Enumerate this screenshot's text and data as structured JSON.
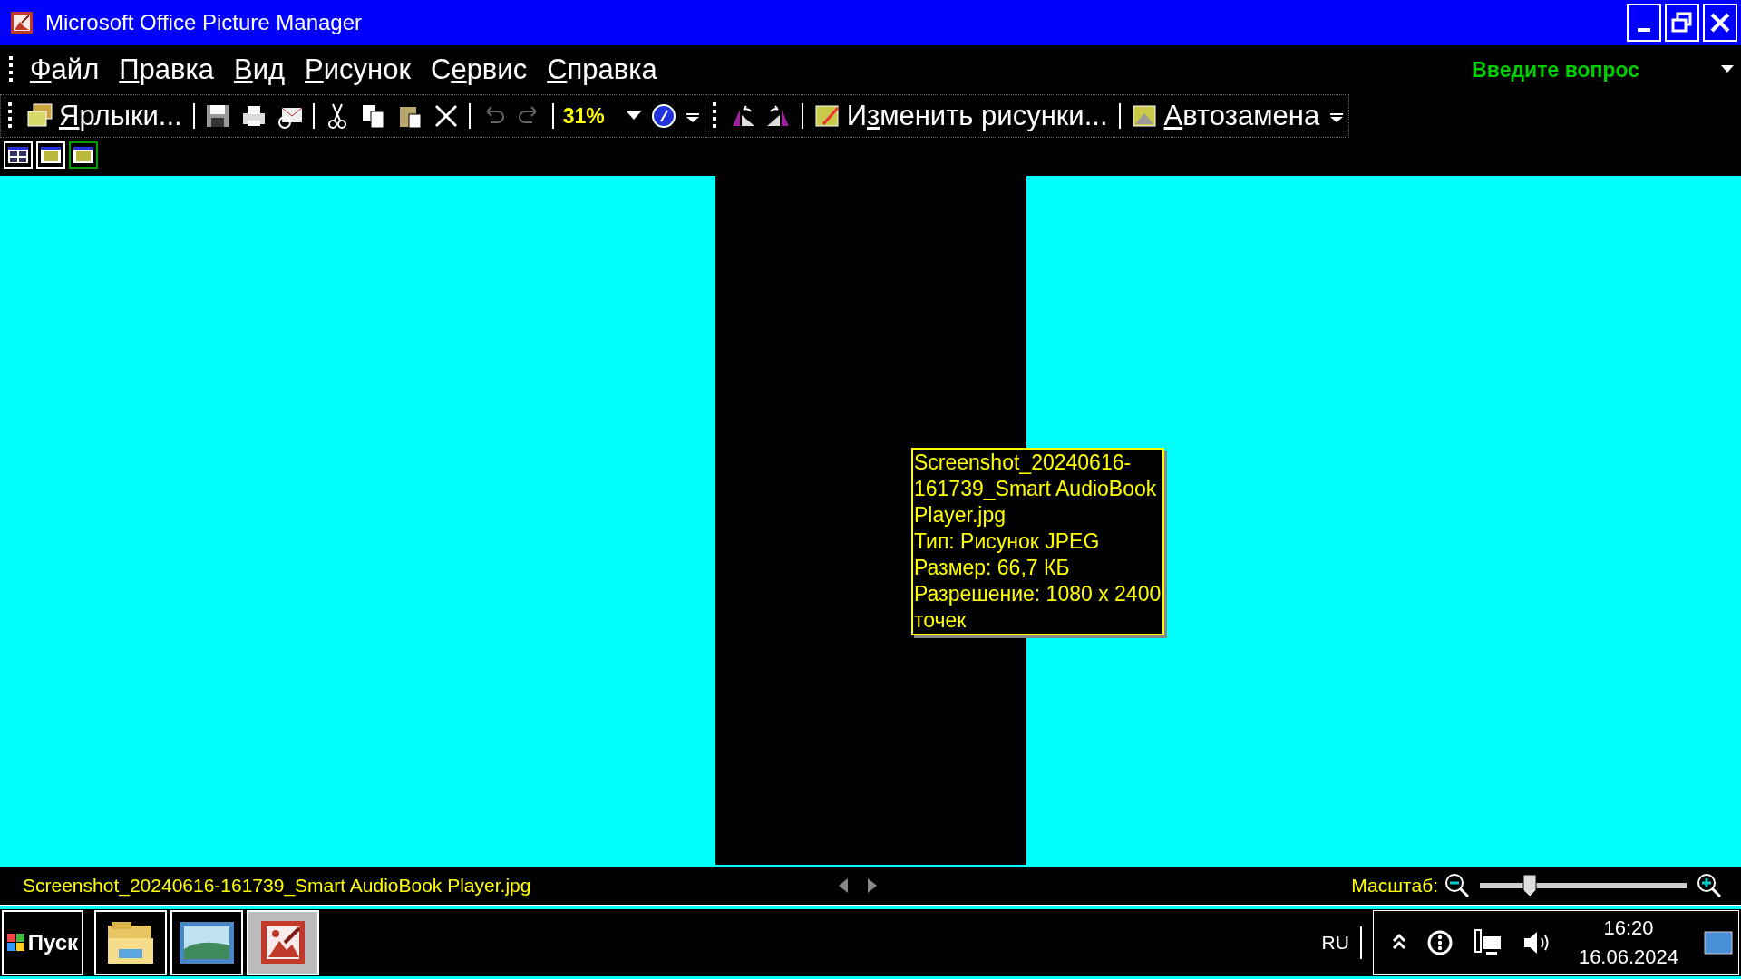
{
  "window": {
    "title": "Microsoft Office Picture Manager"
  },
  "menu": [
    {
      "key": "Ф",
      "post": "айл"
    },
    {
      "key": "П",
      "post": "равка"
    },
    {
      "key": "В",
      "post": "ид"
    },
    {
      "key": "Р",
      "post": "исунок"
    },
    {
      "pre": "С",
      "key": "е",
      "post": "рвис"
    },
    {
      "key": "С",
      "post": "правка"
    }
  ],
  "help_box": {
    "placeholder": "Введите вопрос"
  },
  "toolbar": {
    "shortcuts": {
      "key": "Я",
      "post": "рлыки..."
    },
    "zoom": "31%",
    "edit": {
      "pre": "И",
      "key": "з",
      "post": "менить рисунки..."
    },
    "autofix": {
      "key": "А",
      "post": "втозамена"
    }
  },
  "view_buttons": [
    {
      "selected": false
    },
    {
      "selected": false
    },
    {
      "selected": true
    }
  ],
  "tooltip": {
    "lines": [
      "Screenshot_20240616-",
      "161739_Smart AudioBook",
      "Player.jpg",
      "Тип: Рисунок JPEG",
      "Размер: 66,7 КБ",
      "Разрешение: 1080 x 2400",
      "точек"
    ]
  },
  "status_bar": {
    "file_name": "Screenshot_20240616-161739_Smart AudioBook Player.jpg",
    "zoom_label": "Масштаб:",
    "zoom": {
      "level": 0.24
    }
  },
  "taskbar": {
    "start": "Пуск",
    "apps": [
      {
        "kind": "folder",
        "selected": false
      },
      {
        "kind": "photo",
        "selected": false
      },
      {
        "kind": "picture-manager",
        "selected": true
      }
    ],
    "language": "RU",
    "time": "16:20",
    "date": "16.06.2024"
  }
}
